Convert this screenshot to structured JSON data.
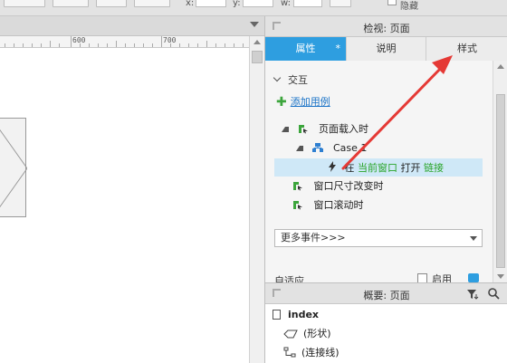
{
  "toolbar": {
    "x_label": "x:",
    "y_label": "y:",
    "w_label": "w:",
    "hidden_label": "隐藏"
  },
  "ruler": {
    "marks": [
      "600",
      "700",
      "80"
    ]
  },
  "inspector": {
    "title": "检视: 页面",
    "tabs": [
      {
        "label": "属性",
        "modified": "*"
      },
      {
        "label": "说明"
      },
      {
        "label": "样式"
      }
    ],
    "section": "交互",
    "add_case": "添加用例",
    "events": [
      {
        "label": "页面载入时"
      },
      {
        "label": "Case 1"
      },
      {
        "label_before": "在",
        "label_target": "当前窗口",
        "label_mid": "打开",
        "label_link": "链接"
      },
      {
        "label": "窗口尺寸改变时"
      },
      {
        "label": "窗口滚动时"
      }
    ],
    "more_events": "更多事件>>>",
    "adaptive_label": "自适应",
    "enable_label": "启用"
  },
  "outline": {
    "title": "概要: 页面",
    "items": [
      {
        "label": "index"
      },
      {
        "label": "(形状)"
      },
      {
        "label": "(连接线)"
      }
    ]
  },
  "colors": {
    "accent": "#2e9ee0",
    "annotation_arrow": "#e53935",
    "link_green": "#2aa52a",
    "selection": "#cfe8f7"
  }
}
